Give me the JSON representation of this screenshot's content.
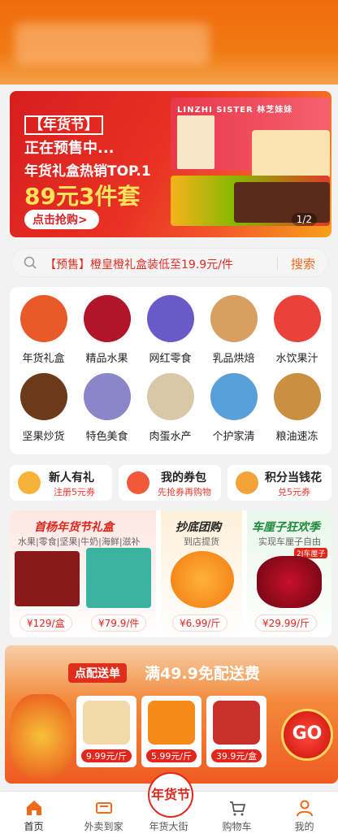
{
  "banner": {
    "tag": "【年货节】",
    "line2": "正在预售中...",
    "line3": "年货礼盒热销TOP.1",
    "price": "89元3件套",
    "button": "点击抢购>",
    "art_text": "LINZHI SISTER 林芝妹妹",
    "indicator": "1/2"
  },
  "search": {
    "text": "【预售】橙皇橙礼盒装低至19.9元/件",
    "button": "搜索"
  },
  "categories": [
    {
      "label": "年货礼盒",
      "color": "#e85a2a"
    },
    {
      "label": "精品水果",
      "color": "#b0152a"
    },
    {
      "label": "网红零食",
      "color": "#6a5ac8"
    },
    {
      "label": "乳品烘焙",
      "color": "#d8a060"
    },
    {
      "label": "水饮果汁",
      "color": "#e8423a"
    },
    {
      "label": "坚果炒货",
      "color": "#6a3a1a"
    },
    {
      "label": "特色美食",
      "color": "#8a86c8"
    },
    {
      "label": "肉蛋水产",
      "color": "#d8c8a8"
    },
    {
      "label": "个护家清",
      "color": "#5aa0d8"
    },
    {
      "label": "粮油速冻",
      "color": "#c89040"
    }
  ],
  "promos": [
    {
      "title": "新人有礼",
      "sub": "注册5元券"
    },
    {
      "title": "我的券包",
      "sub": "先抢券再购物"
    },
    {
      "title": "积分当钱花",
      "sub": "兑5元券"
    }
  ],
  "deals": {
    "main_title": "首杨年货节礼盒",
    "main_sub": "水果|零食|坚果|牛奶|海鲜|滋补",
    "main_prices": [
      "¥129/盒",
      "¥79.9/件"
    ],
    "group_title": "抄底团购",
    "group_sub": "到店提货",
    "group_price": "¥6.99/斤",
    "cherry_title": "车厘子狂欢季",
    "cherry_sub": "实现车厘子自由",
    "cherry_badge": "2J车厘子",
    "cherry_price": "¥29.99/斤"
  },
  "delivery": {
    "tag": "点配送单",
    "title": "满49.9免配送费",
    "items": [
      "9.99元/斤",
      "5.99元/斤",
      "39.9元/盒"
    ],
    "go": "GO"
  },
  "tabs": [
    "首页",
    "外卖到家",
    "年货大街",
    "购物车",
    "我的"
  ],
  "tab_center_badge": "年货节",
  "colors": {
    "accent": "#f06a1a",
    "price_red": "#e3261c",
    "header": "#ef6c0c"
  }
}
